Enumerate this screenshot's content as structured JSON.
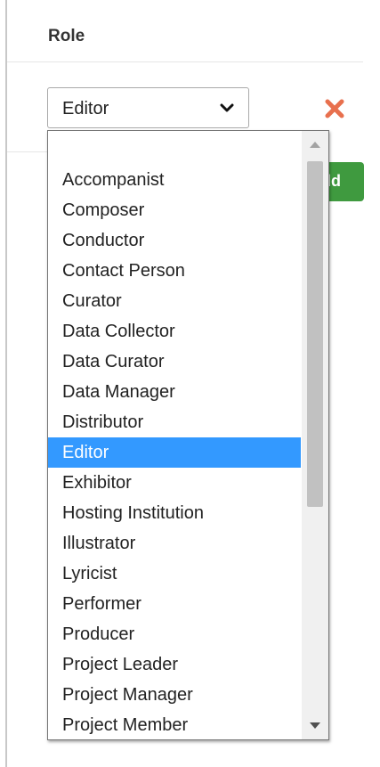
{
  "header": {
    "title": "Role"
  },
  "role_select": {
    "value": "Editor",
    "options": [
      "Accompanist",
      "Composer",
      "Conductor",
      "Contact Person",
      "Curator",
      "Data Collector",
      "Data Curator",
      "Data Manager",
      "Distributor",
      "Editor",
      "Exhibitor",
      "Hosting Institution",
      "Illustrator",
      "Lyricist",
      "Performer",
      "Producer",
      "Project Leader",
      "Project Manager",
      "Project Member"
    ],
    "selected_index": 9
  },
  "add_button": {
    "label": "dd"
  },
  "icons": {
    "remove": "close-icon",
    "select_arrow": "chevron-down-icon",
    "scroll_up": "scroll-up-arrow-icon",
    "scroll_down": "scroll-down-arrow-icon"
  },
  "colors": {
    "selection": "#3399ff",
    "add_button": "#3f9a3f",
    "remove_icon": "#e8704e"
  }
}
